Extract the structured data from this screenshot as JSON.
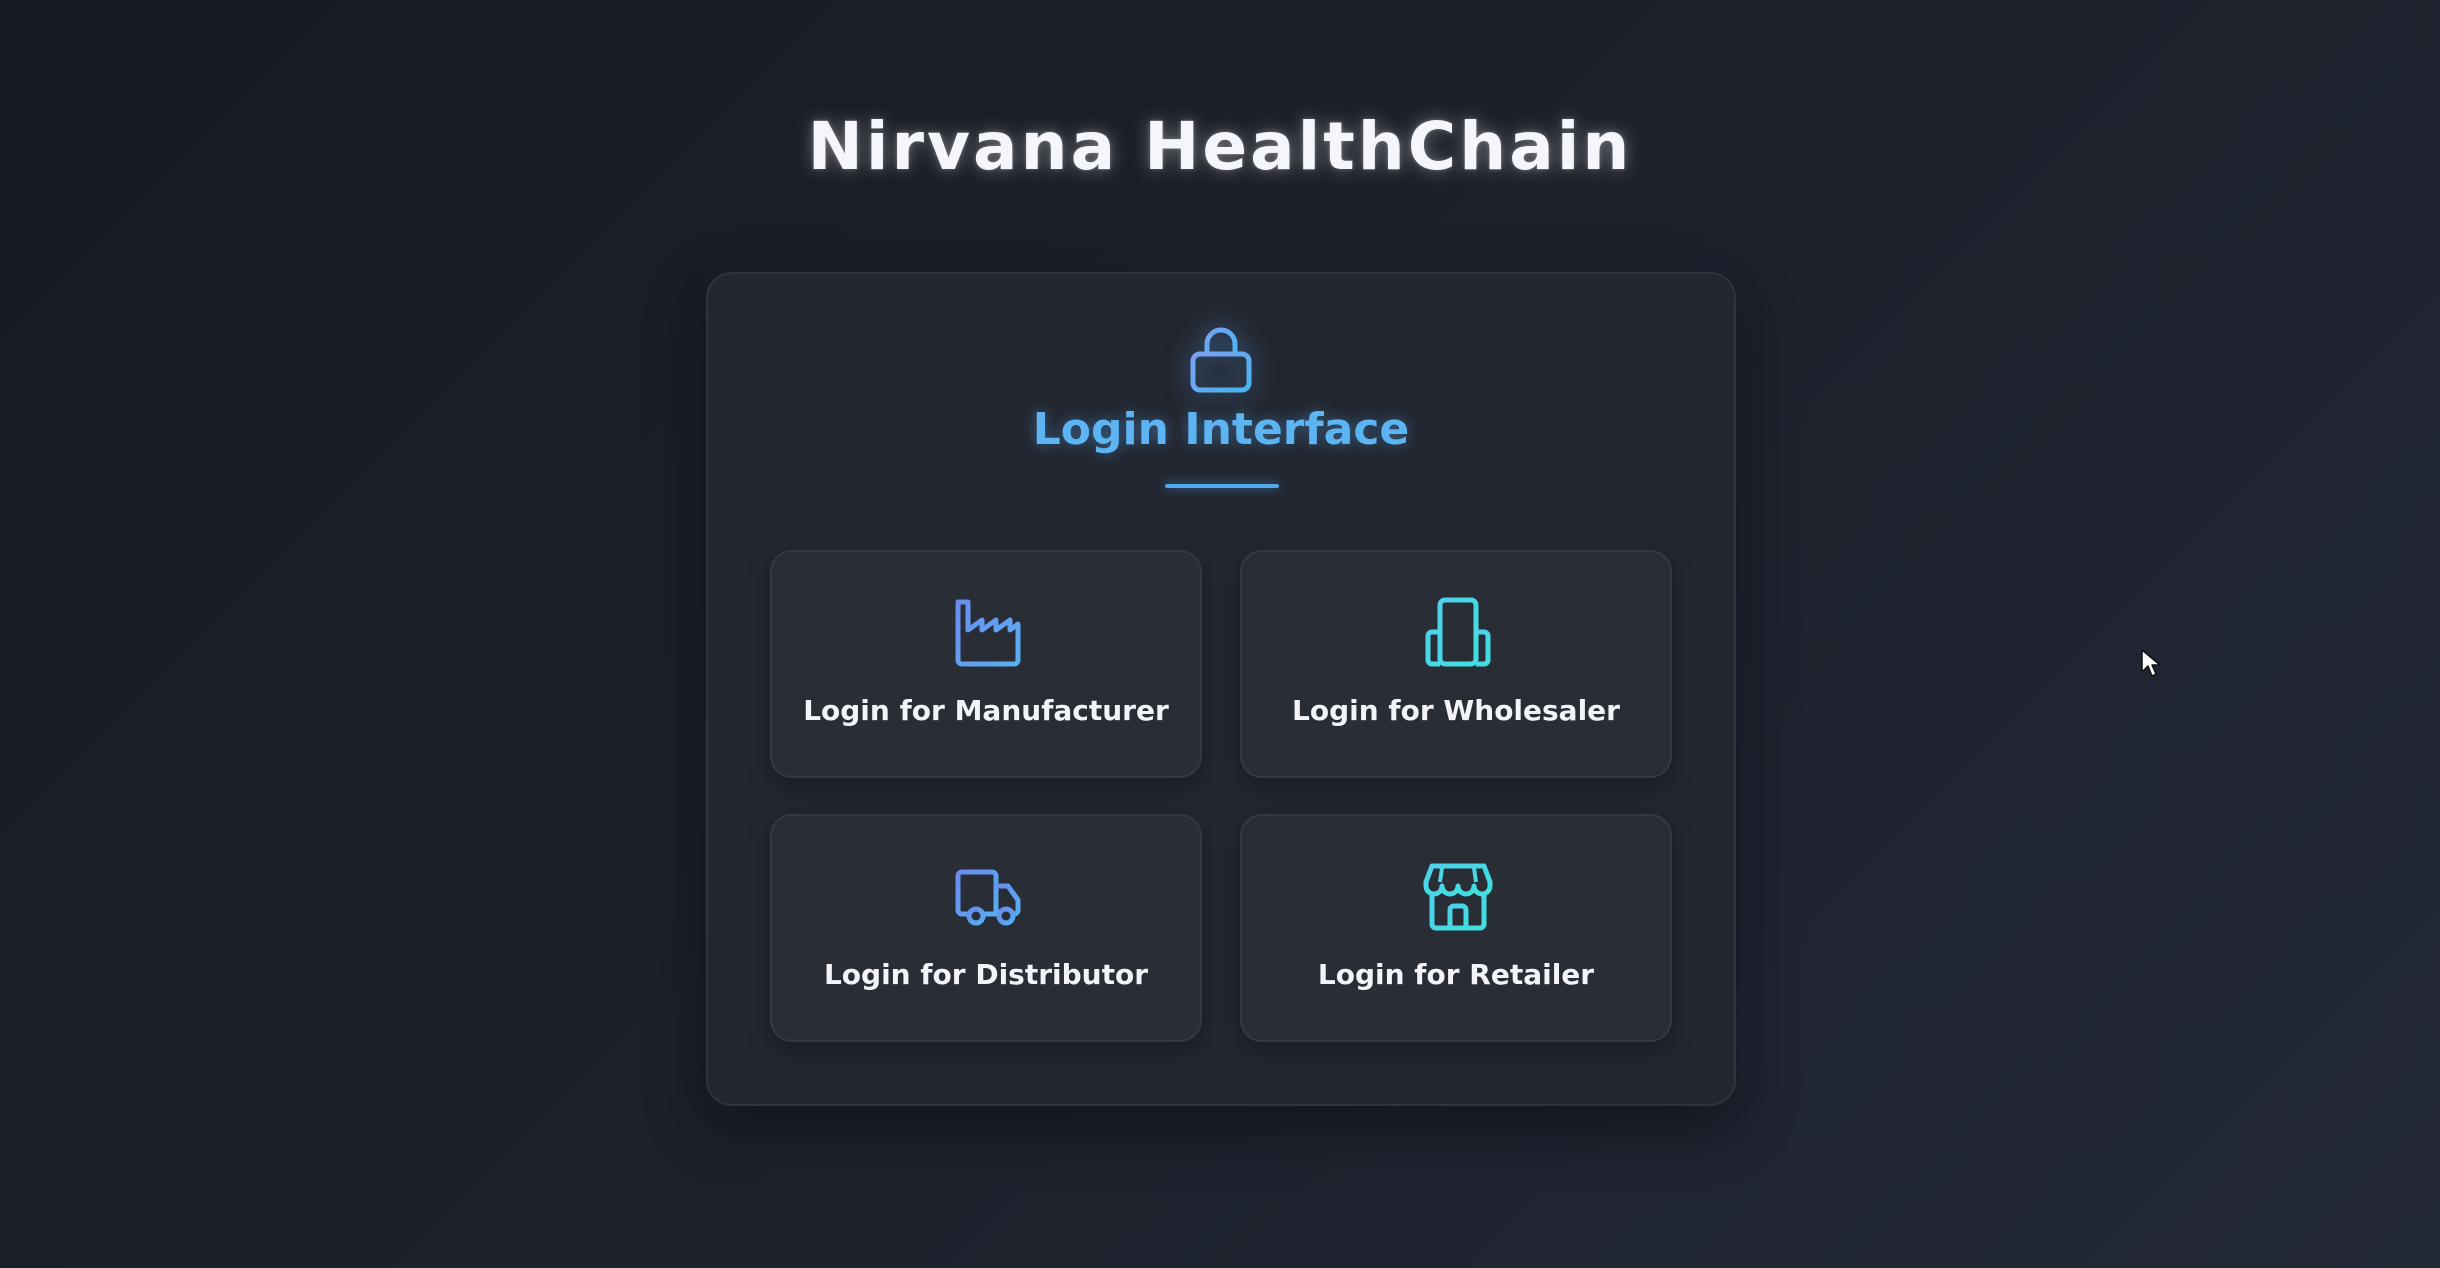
{
  "app": {
    "title": "Nirvana HealthChain"
  },
  "panel": {
    "icon": "lock-icon",
    "title": "Login Interface"
  },
  "options": [
    {
      "label": "Login for Manufacturer",
      "icon": "factory-icon"
    },
    {
      "label": "Login for Wholesaler",
      "icon": "building-icon"
    },
    {
      "label": "Login for Distributor",
      "icon": "truck-icon"
    },
    {
      "label": "Login for Retailer",
      "icon": "store-icon"
    }
  ],
  "colors": {
    "background": "#1c2029",
    "panel": "#232730",
    "card": "#292d36",
    "accent_blue": "#5cb4f2",
    "icon_gradient_start": "#6a8cf0",
    "icon_gradient_end": "#3fe0e8"
  }
}
